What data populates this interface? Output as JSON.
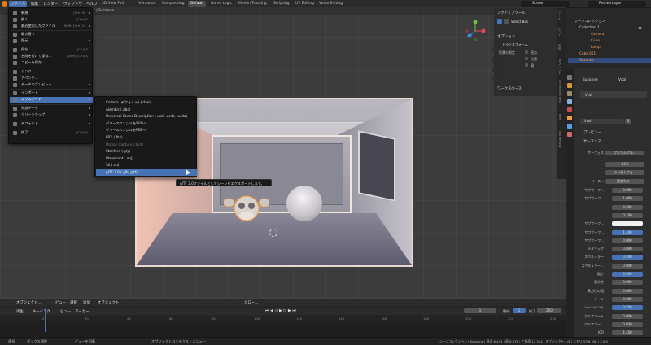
{
  "topbar": {
    "menus": [
      "ファイル",
      "編集",
      "レンダー",
      "ウィンドウ",
      "ヘルプ"
    ],
    "workspaces": [
      "3D View Full",
      "Animation",
      "Compositing",
      "Default",
      "Game Logic",
      "Motion Tracking",
      "Scripting",
      "UV Editing",
      "Video Editing"
    ],
    "active_workspace": "Default",
    "scene": "Scene",
    "render_layer": "RenderLayer"
  },
  "viewport": {
    "title_fragment": "r | Suzanne",
    "header_items": [
      "オブジェクト...",
      "ビュー",
      "選択",
      "追加",
      "オブジェクト"
    ],
    "shading": "グロー..."
  },
  "file_menu": {
    "items": [
      {
        "label": "新規",
        "shortcut": "[Ctrl] N",
        "arrow": "▸"
      },
      {
        "label": "開く...",
        "shortcut": "[Ctrl] O"
      },
      {
        "label": "最近使用したファイル",
        "shortcut": "[Shift] [Ctrl] O",
        "arrow": "▸"
      },
      {
        "label": "開き直す"
      },
      {
        "label": "復元",
        "arrow": "▸"
      },
      {
        "label": "保存",
        "shortcut": "[Ctrl] S"
      },
      {
        "label": "名前を付けて保存...",
        "shortcut": "[Shift] [Ctrl] S"
      },
      {
        "label": "コピーを保存..."
      },
      {
        "label": "リンク..."
      },
      {
        "label": "アペンド..."
      },
      {
        "label": "データのプレビュー",
        "arrow": "▸"
      },
      {
        "label": "インポート",
        "arrow": "▸"
      },
      {
        "label": "エクスポート",
        "arrow": "▸"
      },
      {
        "label": "外部データ",
        "arrow": "▸"
      },
      {
        "label": "クリーンアップ",
        "arrow": "▸"
      },
      {
        "label": "デフォルト",
        "arrow": "▸"
      },
      {
        "label": "終了",
        "shortcut": "[Ctrl] Q"
      }
    ]
  },
  "export_menu": {
    "items": [
      "Collada (デフォルト) (.dae)",
      "Alembic (.abc)",
      "Universal Scene Description (.usd, .usdc, .usda)",
      "グリースペンシルをSVGへ",
      "グリースペンシルをPDFへ",
      "FBX (.fbx)",
      "Motion Capture (.bvh)",
      "Stanford (.ply)",
      "Wavefront (.obj)",
      "Stl (.stl)",
      "glTF 2.0 (.glb/.gltf)"
    ],
    "tooltip": "glTF 2.0ファイルとしてシーンをエクスポートします。"
  },
  "side_panel": {
    "active_tool": "アクティブツール",
    "select_box": "Select Box",
    "options": "オプション",
    "transform": "トランスフォーム",
    "affect_only": "影響の限定",
    "origins": "原点",
    "locations": "位置",
    "parents": "親",
    "workspace": "ワークスペース"
  },
  "side_tabs": [
    "ツール",
    "ビュー",
    "作成",
    "3Dプリント",
    "Screencast Keys",
    "Item",
    "Tool Density"
  ],
  "outliner": {
    "rows": [
      {
        "label": "シーンコレクション"
      },
      {
        "label": "Collection 1"
      },
      {
        "label": "Camera"
      },
      {
        "label": "Cube"
      },
      {
        "label": "Lamp"
      },
      {
        "label": "Cube.001"
      },
      {
        "label": "Suzanne"
      }
    ]
  },
  "properties": {
    "object": "Suzanne",
    "material_slot": "Vcol",
    "material_name": "Vcol",
    "users": "3",
    "sections": [
      "プレビュー",
      "サーフェス"
    ],
    "surface_label": "サーフェス",
    "surface_value": "プリンシプル...",
    "distribution": "GGX",
    "subsurface_method": "ランダムウォ...",
    "base_color_label": "ベース...",
    "base_color_value": "頂点カラー",
    "rows": [
      {
        "label": "サブサーフ...",
        "value": "0.000"
      },
      {
        "label": "サブサーフ...",
        "value": "1.000"
      },
      {
        "label": "",
        "value": "0.200"
      },
      {
        "label": "",
        "value": "0.100"
      },
      {
        "label": "サブサーフ...",
        "value": ""
      },
      {
        "label": "サブサーフ...",
        "value": "1.400"
      },
      {
        "label": "サブサーフ...",
        "value": "0.000"
      },
      {
        "label": "メタリック",
        "value": "0.000"
      },
      {
        "label": "スペキュラー",
        "value": "0.500"
      },
      {
        "label": "スペキュラー...",
        "value": "0.000"
      },
      {
        "label": "粗さ",
        "value": "0.500"
      },
      {
        "label": "異方性",
        "value": "0.000"
      },
      {
        "label": "異方性の回",
        "value": "0.000"
      },
      {
        "label": "シーン",
        "value": "0.000"
      },
      {
        "label": "シーンチント",
        "value": "0.500"
      },
      {
        "label": "クリアコート",
        "value": "0.000"
      },
      {
        "label": "クリアコー...",
        "value": "0.030"
      },
      {
        "label": "IOR",
        "value": "1.450"
      }
    ]
  },
  "timeline": {
    "header": [
      "再生",
      "キーイング",
      "ビュー",
      "マーカー"
    ],
    "current_frame": "1",
    "start_label": "開始",
    "start": "1",
    "end_label": "終了",
    "end": "250",
    "ruler": [
      "0",
      "20",
      "40",
      "60",
      "80",
      "100",
      "120",
      "140",
      "160",
      "180",
      "200",
      "220",
      "240"
    ]
  },
  "statusbar": {
    "left": [
      "選択",
      "ボックス選択",
      "ビューを回転",
      "オブジェクトコンテクストメニュー"
    ],
    "right": "シーンコレクション | Suzanne | 頂点:6,445 | 面:6,678 | 三角面:13,324 | オブジェクト:1/5 | メモリ:53.8 MiB | 3.0.0"
  }
}
